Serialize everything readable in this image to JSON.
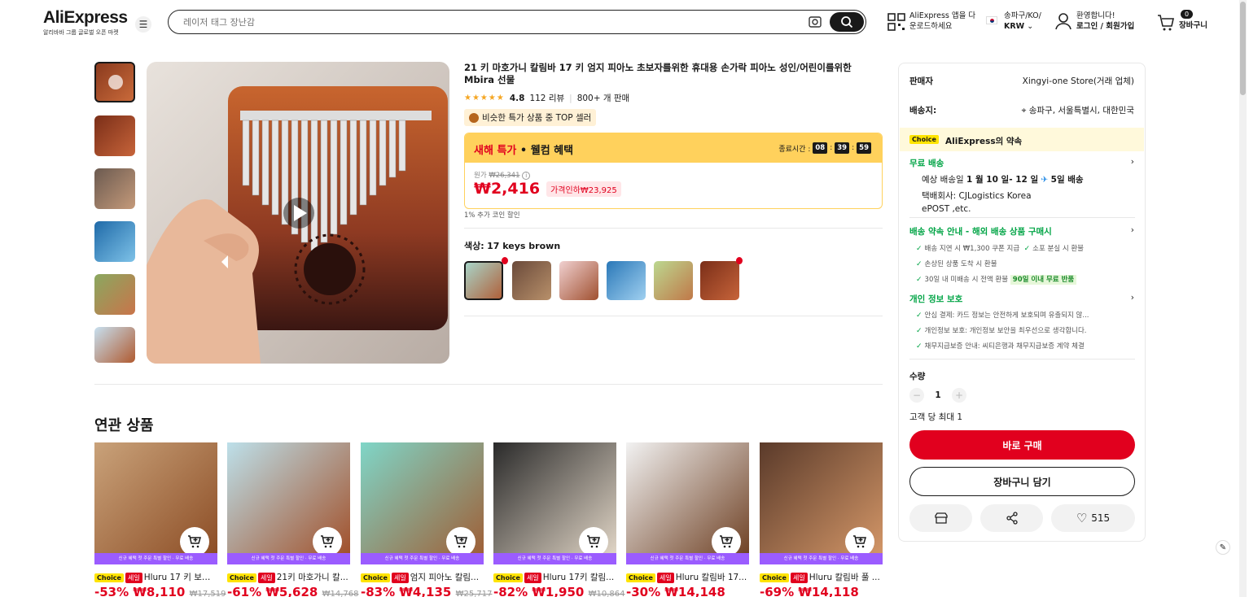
{
  "header": {
    "logo": "AliExpress",
    "logo_tagline": "알리바바 그룹 글로벌 오픈 마켓",
    "search_placeholder": "레이저 태그 장난감",
    "app_download": "AliExpress 앱을 다 운로드하세요",
    "locale_line1": "송파구/KO/",
    "locale_line2": "KRW",
    "welcome": "환영합니다!",
    "login": "로그인 / 회원가입",
    "cart_count": "0",
    "cart_label": "장바구니"
  },
  "product": {
    "title": "21 키 마호가니 칼림바 17 키 엄지 피아노 초보자를위한 휴대용 손가락 피아노 성인/어린이를위한 Mbira 선물",
    "rating": "4.8",
    "reviews": "112 리뷰",
    "sold": "800+ 개 판매",
    "top_seller_badge": "비슷한 특가 상품 중 TOP 셀러",
    "promo_title_red": "새해 특가",
    "promo_title_rest": " • 웰컴 혜택",
    "countdown_label": "종료시간 :",
    "countdown": [
      "08",
      "39",
      "59"
    ],
    "original_label": "원가",
    "original_price": "₩26,341",
    "price": "₩2,416",
    "discount_label": "가격인하₩23,925",
    "coin_discount": "1% 추가 코인 할인",
    "color_label": "색상:",
    "color_value": "17 keys brown"
  },
  "seller_panel": {
    "seller_label": "판매자",
    "seller_name": "Xingyi-one Store(거래 업체)",
    "ship_to_label": "배송지:",
    "ship_to": "송파구, 서울특별시, 대한민국",
    "choice_tag": "Choice",
    "promise": "AliExpress의 약속",
    "free_shipping": "무료 배송",
    "delivery_prefix": "예상 배송일",
    "delivery_date": "1 월 10 일- 12 일",
    "delivery_days": "5일 배송",
    "carrier_label": "택배회사:",
    "carrier1": "CJLogistics",
    "carrier2": "Korea",
    "carrier3": "ePOST ,etc.",
    "guarantee_title": "배송 약속 안내 - 해외 배송 상품 구매시",
    "guarantee_items": [
      "배송 지연 시 ₩1,300 쿠폰 지급",
      "소포 분실 시 환불",
      "손상된 상품 도착 시 환불",
      "30일 내 미배송 시 전액 환불"
    ],
    "return_badge": "90일 이내 무료 반품",
    "privacy_title": "개인 정보 보호",
    "privacy_items": [
      "안심 결제: 카드 정보는 안전하게 보호되며 유출되지 않...",
      "개인정보 보호: 개인정보 보안을 최우선으로 생각합니다.",
      "채무지급보증 안내: 씨티은행과 채무지급보증 계약 체결"
    ],
    "qty_label": "수량",
    "qty_value": "1",
    "max_per_customer": "고객 당 최대 1",
    "buy_now": "바로 구매",
    "add_to_cart": "장바구니 담기",
    "wish_count": "515"
  },
  "related": {
    "title": "연관 상품",
    "banner_text": "신규 혜택 첫 주문 특별 할인 · 무료 배송",
    "choice": "Choice",
    "sale": "세일",
    "items": [
      {
        "name": "Hluru 17 키 보드...",
        "discount": "-53%",
        "price": "₩8,110",
        "original": "₩17,519"
      },
      {
        "name": "21키 마호가니 칼...",
        "discount": "-61%",
        "price": "₩5,628",
        "original": "₩14,768"
      },
      {
        "name": "엄지 피아노 칼림...",
        "discount": "-83%",
        "price": "₩4,135",
        "original": "₩25,717"
      },
      {
        "name": "Hluru 17키 칼림...",
        "discount": "-82%",
        "price": "₩1,950",
        "original": "₩10,864"
      },
      {
        "name": "Hluru 칼림바 17...",
        "discount": "-30%",
        "price": "₩14,148",
        "original": ""
      },
      {
        "name": "Hluru 칼림바 풀 ...",
        "discount": "-69%",
        "price": "₩14,118",
        "original": ""
      }
    ]
  }
}
